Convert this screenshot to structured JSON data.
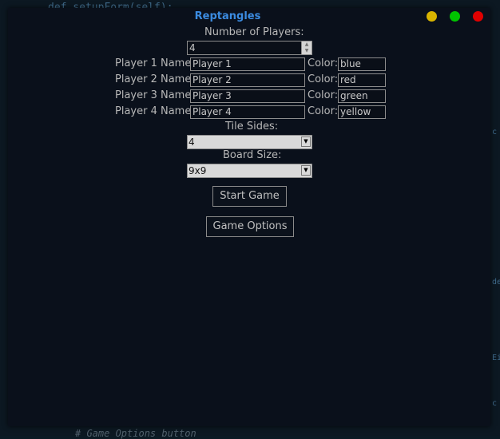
{
  "window": {
    "title": "Reptangles",
    "controls": {
      "minimize_color": "#d9b400",
      "maximize_color": "#00c400",
      "close_color": "#e00000"
    }
  },
  "form": {
    "num_players_label": "Number of Players:",
    "num_players_value": "4",
    "players": [
      {
        "name_label": "Player 1 Name:",
        "name_value": "Player 1",
        "color_label": "Color:",
        "color_value": "blue"
      },
      {
        "name_label": "Player 2 Name:",
        "name_value": "Player 2",
        "color_label": "Color:",
        "color_value": "red"
      },
      {
        "name_label": "Player 3 Name:",
        "name_value": "Player 3",
        "color_label": "Color:",
        "color_value": "green"
      },
      {
        "name_label": "Player 4 Name:",
        "name_value": "Player 4",
        "color_label": "Color:",
        "color_value": "yellow"
      }
    ],
    "tile_sides_label": "Tile Sides:",
    "tile_sides_value": "4",
    "board_size_label": "Board Size:",
    "board_size_value": "9x9"
  },
  "buttons": {
    "start_game": "Start Game",
    "game_options": "Game Options"
  },
  "background_editor": {
    "top_line": "def setupForm(self):",
    "bottom_comment": "# Game Options button",
    "fragments": [
      "c",
      "de",
      "Ei",
      "c"
    ]
  },
  "colors": {
    "title": "#3b8be0",
    "window_bg": "#0a101b",
    "label": "#b8b8b8"
  }
}
